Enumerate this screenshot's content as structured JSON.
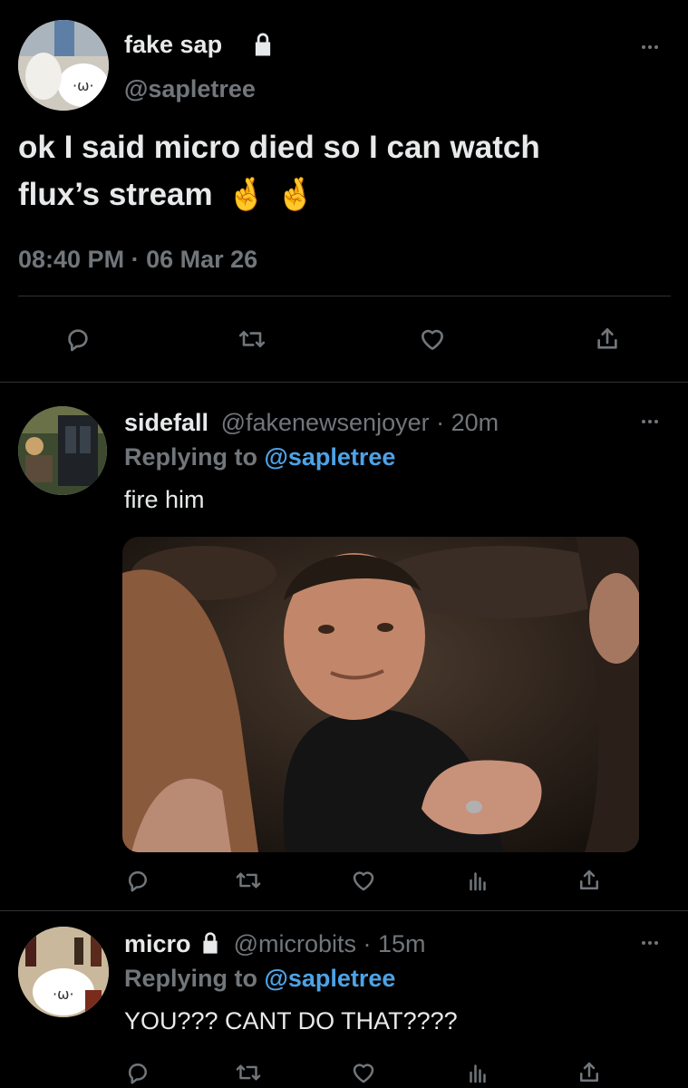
{
  "main_tweet": {
    "display_name": "fake sap",
    "handle": "@sapletree",
    "text_line1": "ok I said micro died so I can watch",
    "text_line2": "flux’s stream",
    "emoji": "🤞🤞",
    "time": "08:40 PM",
    "separator": "·",
    "date": "06 Mar 26"
  },
  "reply1": {
    "display_name": "sidefall",
    "handle": "@fakenewsenjoyer",
    "separator": "·",
    "age": "20m",
    "replying_prefix": "Replying to",
    "replying_handle": "@sapletree",
    "text": "fire him"
  },
  "reply2": {
    "display_name": "micro",
    "handle": "@microbits",
    "separator": "·",
    "age": "15m",
    "replying_prefix": "Replying to",
    "replying_handle": "@sapletree",
    "text": "YOU??? CANT DO THAT????"
  },
  "icons": {
    "reply": "speech-bubble-icon",
    "retweet": "retweet-icon",
    "like": "heart-icon",
    "analytics": "bar-chart-icon",
    "share": "share-icon",
    "more": "more-dots-icon",
    "lock": "lock-icon"
  },
  "colors": {
    "background": "#000000",
    "text": "#e7e9ea",
    "muted": "#71767b",
    "link": "#4ea2e6",
    "divider": "#2f3336"
  }
}
